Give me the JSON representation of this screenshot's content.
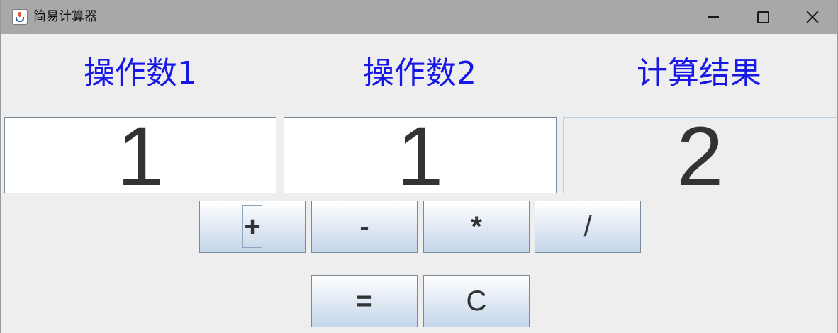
{
  "window": {
    "title": "简易计算器",
    "app_icon": "java-coffee-cup-icon"
  },
  "controls": {
    "minimize_icon": "minimize-icon",
    "maximize_icon": "maximize-icon",
    "close_icon": "close-icon"
  },
  "headers": {
    "operand1": "操作数1",
    "operand2": "操作数2",
    "result": "计算结果"
  },
  "fields": {
    "operand1_value": "1",
    "operand2_value": "1",
    "result_value": "2"
  },
  "buttons": {
    "add": "+",
    "subtract": "-",
    "multiply": "*",
    "divide": "/",
    "equals": "=",
    "clear": "C"
  },
  "colors": {
    "header_text": "#1717e6",
    "titlebar": "#a8a8a8",
    "background": "#eeeeee"
  }
}
